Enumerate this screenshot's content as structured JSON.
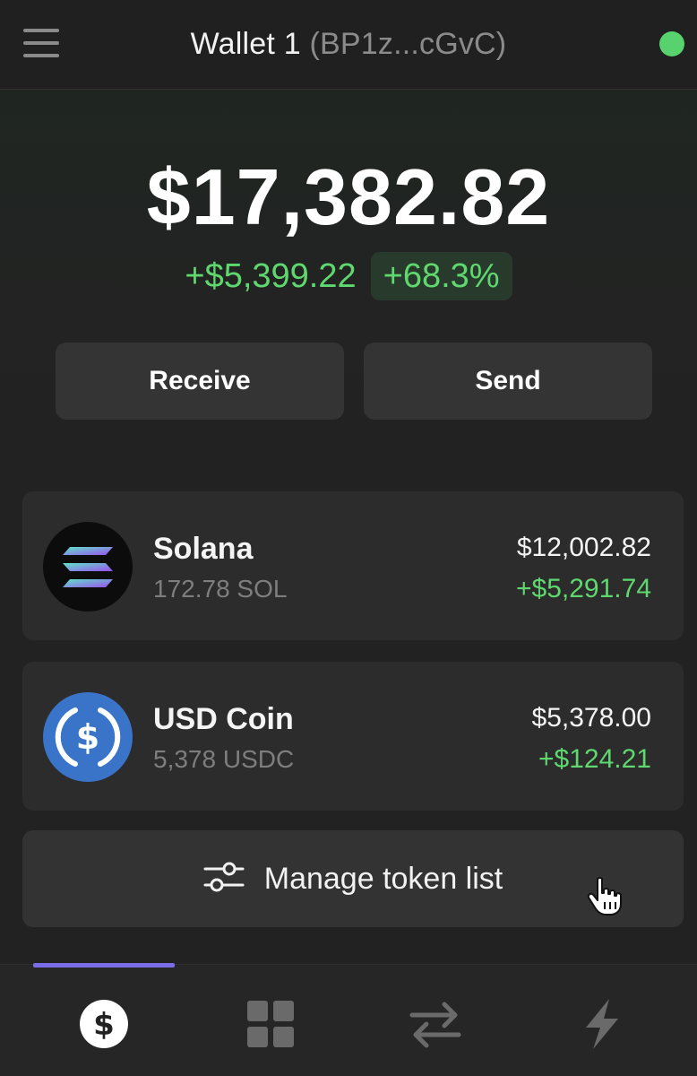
{
  "header": {
    "wallet_name": "Wallet 1",
    "wallet_address": "(BP1z...cGvC)",
    "status_color": "#58d26c"
  },
  "balance": {
    "total": "$17,382.82",
    "change_amount": "+$5,399.22",
    "change_percent": "+68.3%"
  },
  "actions": {
    "receive_label": "Receive",
    "send_label": "Send"
  },
  "tokens": [
    {
      "name": "Solana",
      "amount": "172.78 SOL",
      "value": "$12,002.82",
      "change": "+$5,291.74",
      "icon": "solana-logo-icon"
    },
    {
      "name": "USD Coin",
      "amount": "5,378 USDC",
      "value": "$5,378.00",
      "change": "+$124.21",
      "icon": "usdc-logo-icon"
    }
  ],
  "manage": {
    "label": "Manage token list",
    "icon": "sliders-icon"
  },
  "nav": {
    "items": [
      {
        "name": "wallet",
        "icon": "dollar-icon",
        "active": true
      },
      {
        "name": "collectibles",
        "icon": "grid-icon",
        "active": false
      },
      {
        "name": "swap",
        "icon": "swap-arrows-icon",
        "active": false
      },
      {
        "name": "activity",
        "icon": "lightning-icon",
        "active": false
      }
    ],
    "accent_color": "#7b6ce8"
  },
  "colors": {
    "positive": "#5fd86f",
    "background": "#222222",
    "card": "#2c2c2c"
  }
}
